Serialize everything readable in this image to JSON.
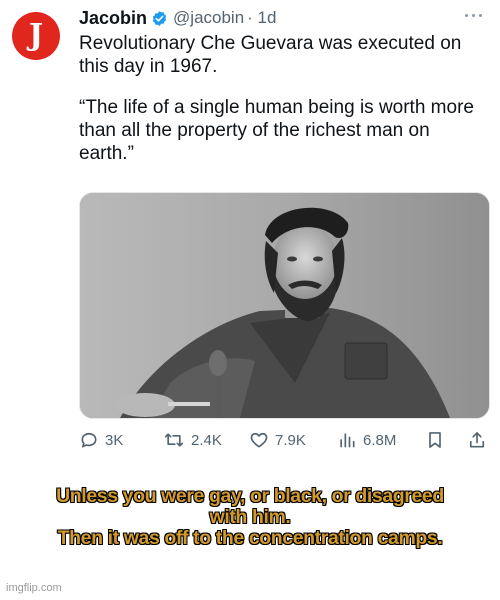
{
  "tweet": {
    "account_name": "Jacobin",
    "handle": "@jacobin",
    "time": "· 1d",
    "avatar_letter": "J",
    "avatar_color": "#e0261d",
    "verified_icon": "verified-badge-icon",
    "lines": [
      "Revolutionary Che Guevara was executed on this day in 1967.",
      "“The life of a single human being is worth more than all the property of the richest man on earth.”"
    ],
    "image_description": "Black-and-white photograph of Che Guevara seated at a microphone",
    "actions": {
      "replies": "3K",
      "retweets": "2.4K",
      "likes": "7.9K",
      "views": "6.8M"
    }
  },
  "caption": {
    "lines": [
      "Unless you were gay, or black, or disagreed",
      "with him.",
      "Then it was off to the concentration camps."
    ],
    "color": "#d29a2c"
  },
  "watermark": "imgflip.com"
}
